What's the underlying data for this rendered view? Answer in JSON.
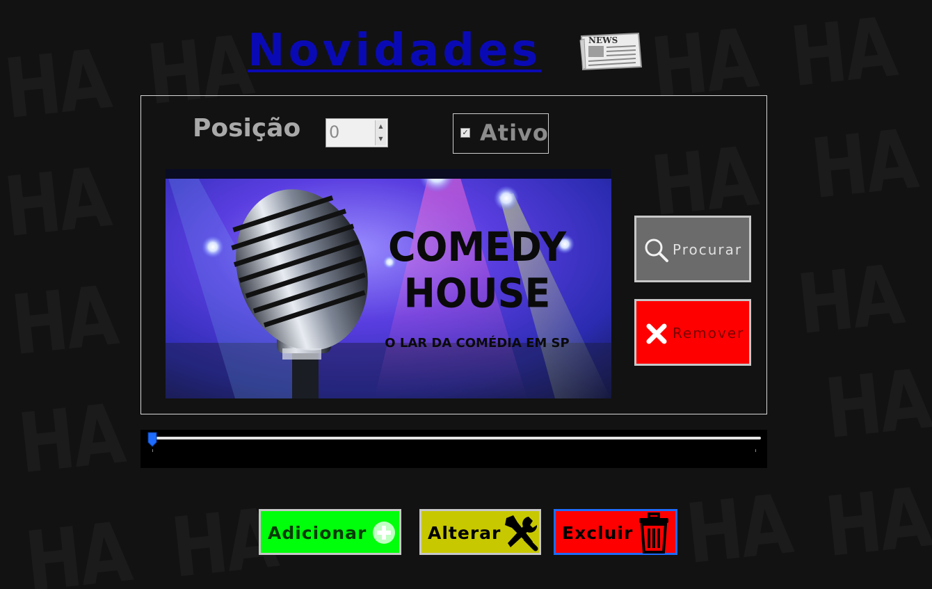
{
  "page": {
    "title": "Novidades",
    "news_icon_text": "NEWS",
    "watermark_text": "HA"
  },
  "form": {
    "position_label": "Posição",
    "position_value": "0",
    "active_label": "Ativo",
    "active_checked": true
  },
  "banner": {
    "headline_line1": "COMEDY",
    "headline_line2": "HOUSE",
    "tagline": "O LAR DA COMÉDIA EM SP"
  },
  "side_buttons": {
    "search_label": "Procurar",
    "remove_label": "Remover"
  },
  "slider": {
    "value_fraction": 0.0
  },
  "actions": {
    "add_label": "Adicionar",
    "edit_label": "Alterar",
    "delete_label": "Excluir"
  },
  "colors": {
    "background": "#121212",
    "title": "#0a0ab4",
    "add": "#00ff0a",
    "edit": "#c8c800",
    "delete": "#ff0000",
    "search": "#6b6b6b",
    "remove": "#ff0000",
    "slider_thumb": "#1e6cff"
  },
  "icons": {
    "news": "newspaper-icon",
    "search": "search-icon",
    "remove": "close-icon",
    "add": "plus-circle-icon",
    "edit": "tools-icon",
    "delete": "trash-icon"
  }
}
